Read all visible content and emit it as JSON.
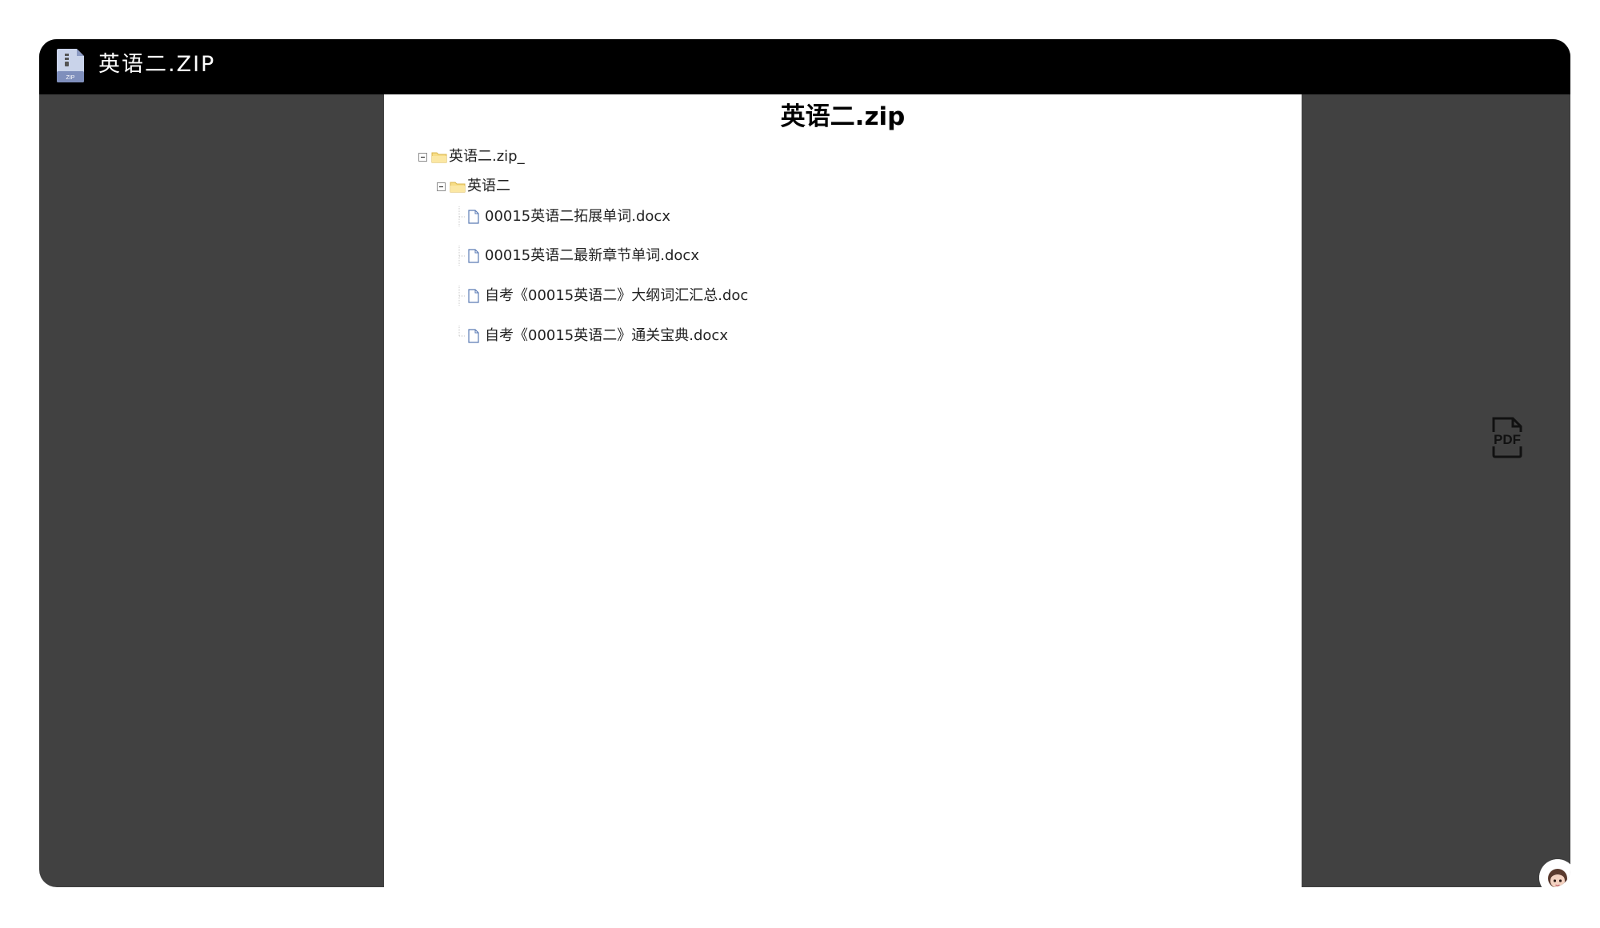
{
  "window": {
    "title": "英语二.ZIP",
    "icon": "zip-archive-icon"
  },
  "document": {
    "title": "英语二.zip"
  },
  "tree": {
    "root": {
      "label": "英语二.zip_",
      "expanded": true,
      "icon": "folder-icon"
    },
    "folder": {
      "label": "英语二",
      "expanded": true,
      "icon": "folder-icon"
    },
    "files": [
      {
        "label": "00015英语二拓展单词.docx",
        "icon": "file-icon"
      },
      {
        "label": "00015英语二最新章节单词.docx",
        "icon": "file-icon"
      },
      {
        "label": "自考《00015英语二》大纲词汇汇总.doc",
        "icon": "file-icon"
      },
      {
        "label": "自考《00015英语二》通关宝典.docx",
        "icon": "file-icon"
      }
    ]
  },
  "actions": {
    "pdf_icon": "pdf-icon",
    "assistant_icon": "avatar-icon"
  },
  "colors": {
    "titlebar": "#000000",
    "background": "#414141",
    "page": "#ffffff",
    "folder": "#f5d36b"
  }
}
